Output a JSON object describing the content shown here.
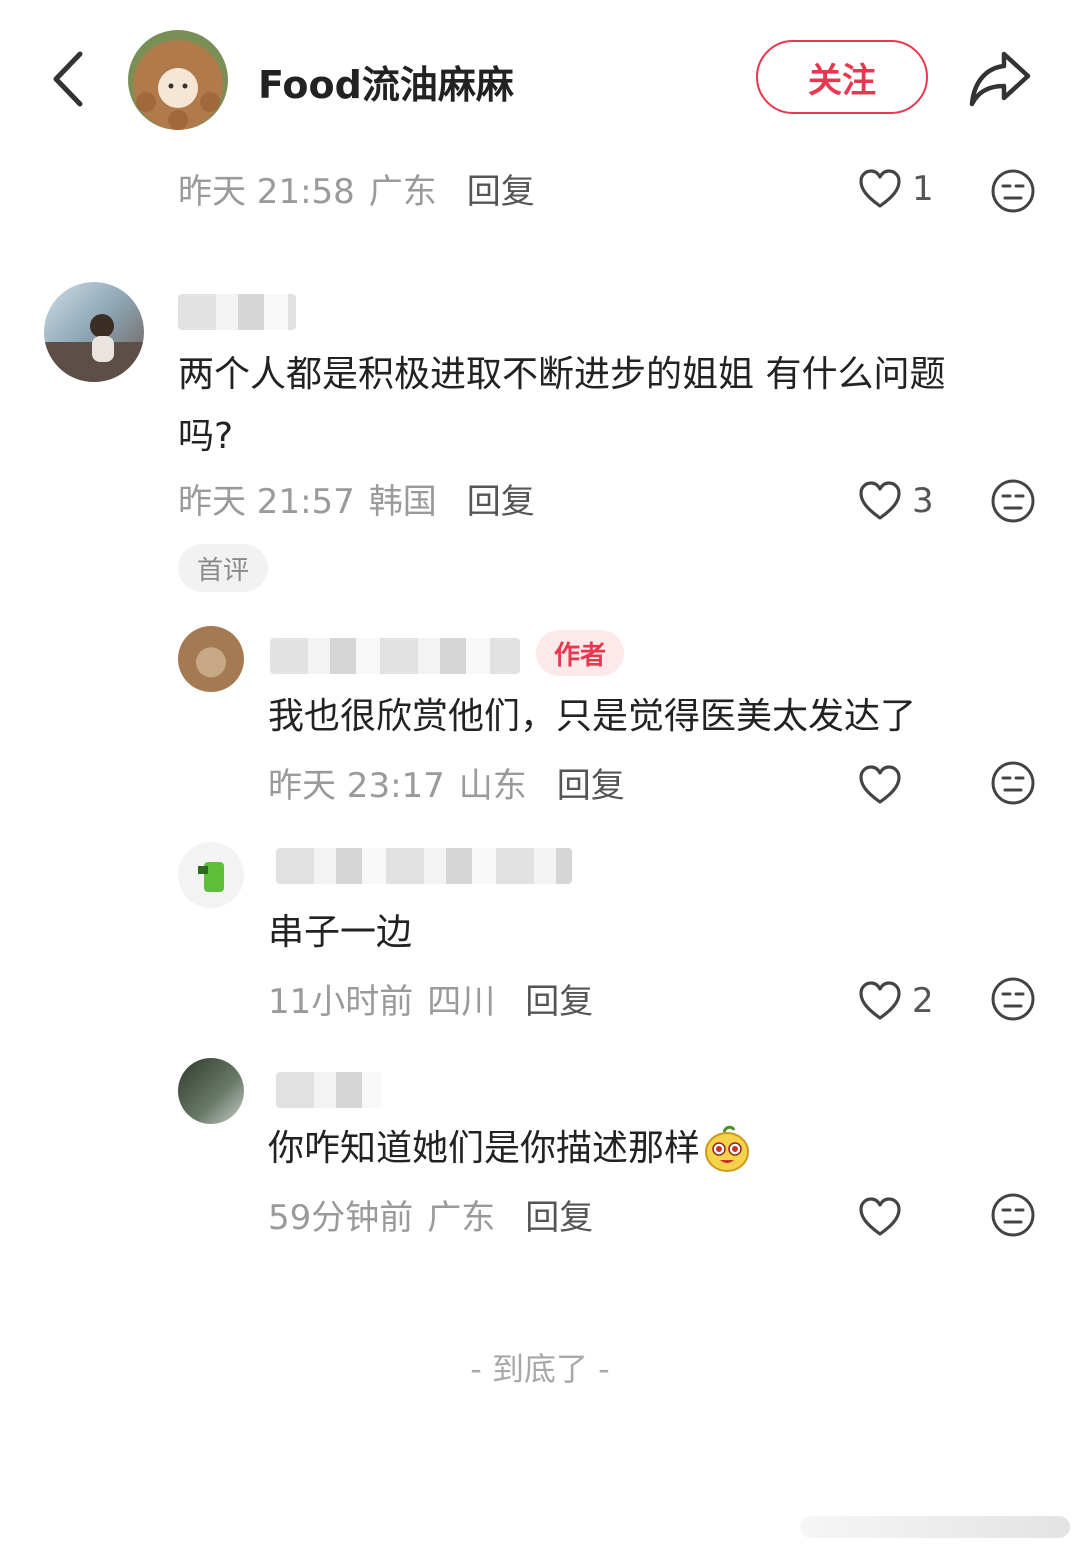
{
  "header": {
    "author_name": "Food流油麻麻",
    "follow_label": "关注"
  },
  "comments": [
    {
      "time": "昨天 21:58",
      "region": "广东",
      "reply_label": "回复",
      "likes": "1"
    },
    {
      "text_line1": "两个人都是积极进取不断进步的姐姐 有什么问题",
      "text_line2": "吗?",
      "time": "昨天 21:57",
      "region": "韩国",
      "reply_label": "回复",
      "likes": "3",
      "badge": "首评",
      "replies": [
        {
          "badge": "作者",
          "text": "我也很欣赏他们，只是觉得医美太发达了",
          "time": "昨天 23:17",
          "region": "山东",
          "reply_label": "回复",
          "likes": ""
        },
        {
          "text": "串子一边",
          "time": "11小时前",
          "region": "四川",
          "reply_label": "回复",
          "likes": "2"
        },
        {
          "text": "你咋知道她们是你描述那样",
          "time": "59分钟前",
          "region": "广东",
          "reply_label": "回复",
          "likes": ""
        }
      ]
    }
  ],
  "footer": {
    "end_label": "- 到底了 -"
  },
  "icons": {
    "back": "chevron-left-icon",
    "share": "share-arrow-icon",
    "like": "heart-outline-icon",
    "react": "neutral-face-icon",
    "emoji": "cartoon-sticker-icon"
  },
  "colors": {
    "accent": "#e8384f",
    "muted_text": "#9a9a9a",
    "badge_bg": "#f2f2f2"
  }
}
